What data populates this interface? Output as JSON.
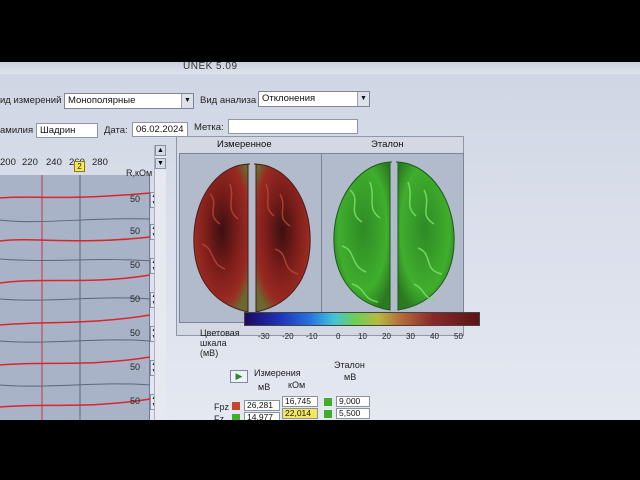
{
  "window": {
    "title": "UNEK 5.09"
  },
  "toolbar": {
    "measure_type_label": "ид измерений",
    "measure_type_value": "Монополярные",
    "analysis_label": "Вид анализа",
    "analysis_value": "Отклонения"
  },
  "patient": {
    "name_label": "амилия",
    "name_value": "Шадрин",
    "date_label": "Дата:",
    "date_value": "06.02.2024",
    "mark_label": "Метка:",
    "mark_value": ""
  },
  "plot": {
    "ticks": [
      "200",
      "220",
      "240",
      "260",
      "280"
    ],
    "marker": "2",
    "unit_label": "R,кОм",
    "channel_values": [
      "50",
      "50",
      "50",
      "50",
      "50",
      "50",
      "50",
      "50"
    ]
  },
  "brains": {
    "measured_title": "Измеренное",
    "reference_title": "Эталон"
  },
  "scale": {
    "label_line1": "Цветовая",
    "label_line2": "шкала",
    "label_line3": "(мВ)",
    "ticks": [
      "-30",
      "-20",
      "-10",
      "0",
      "10",
      "20",
      "30",
      "40",
      "50"
    ]
  },
  "measurements": {
    "header": "Измерения",
    "ref_header": "Эталон",
    "unit_mv": "мВ",
    "unit_kom": "кОм",
    "ref_unit": "мВ",
    "rows": [
      {
        "label": "Fpz",
        "mv": "26,281",
        "kom": "16,745",
        "ref": "9,000"
      },
      {
        "label": "Fz",
        "mv": "14,977",
        "kom": "22,014",
        "ref": "5,500"
      }
    ]
  },
  "colors": {
    "trace_red": "#d8262b",
    "highlight_yellow": "#f3e85a",
    "reference_green": "#3fae2d"
  }
}
